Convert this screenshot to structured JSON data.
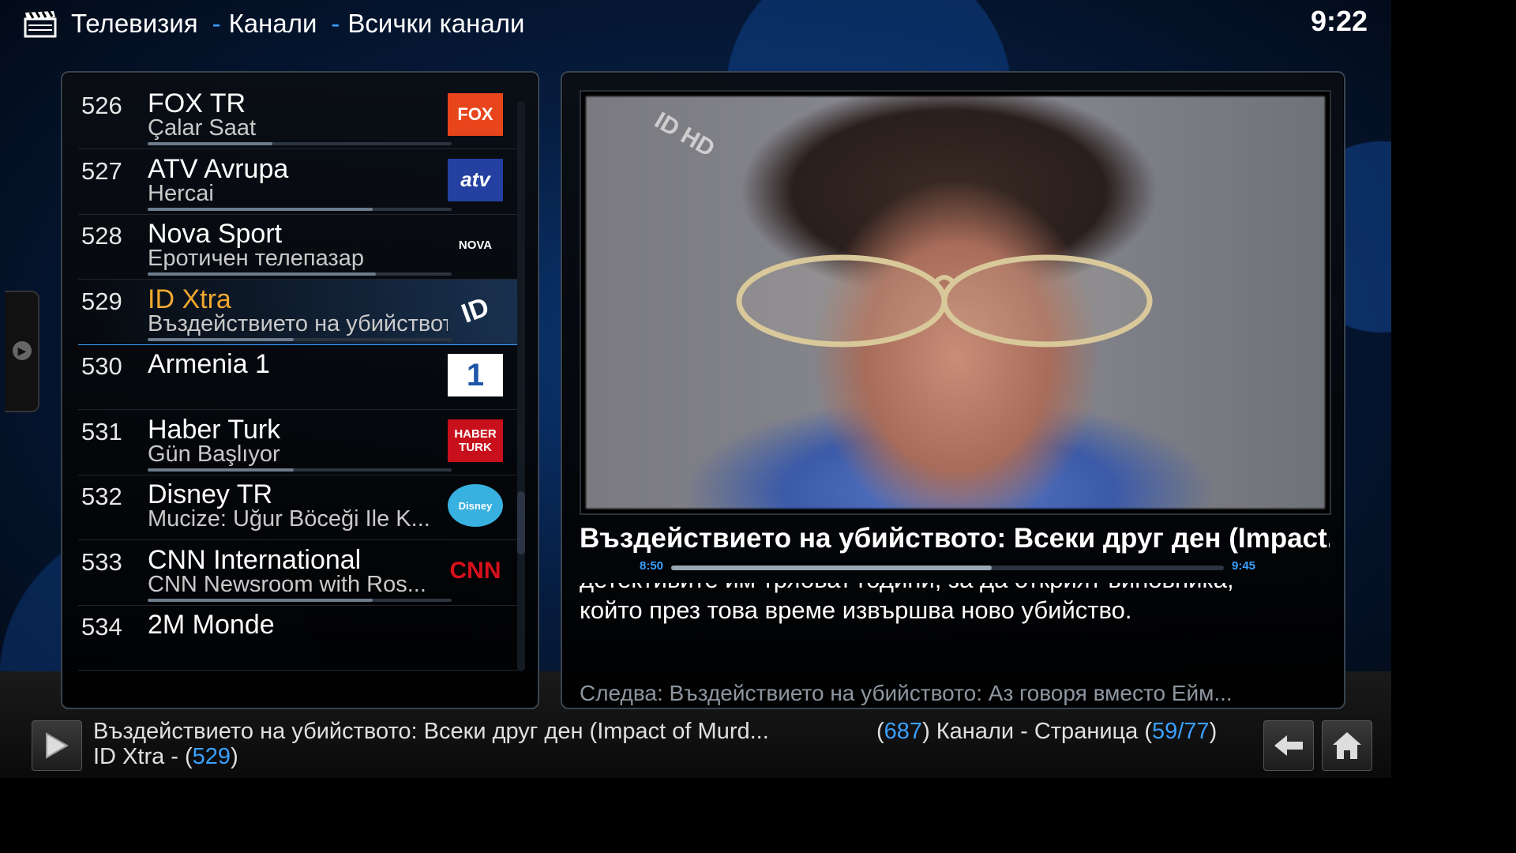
{
  "header": {
    "crumbs": [
      "Телевизия",
      "Канали",
      "Всички канали"
    ],
    "clock": "9:22"
  },
  "channels": [
    {
      "number": "526",
      "name": "FOX TR",
      "program": "Çalar Saat",
      "progress": 0.41,
      "logo": "FOX"
    },
    {
      "number": "527",
      "name": "ATV Avrupa",
      "program": "Hercai",
      "progress": 0.74,
      "logo": "atv"
    },
    {
      "number": "528",
      "name": "Nova Sport",
      "program": "Еротичен телепазар",
      "progress": 0.75,
      "logo": "NOVA"
    },
    {
      "number": "529",
      "name": "ID Xtra",
      "program": "Въздействието на убийството: В",
      "progress": 0.48,
      "logo": "ID",
      "selected": true
    },
    {
      "number": "530",
      "name": "Armenia 1",
      "program": "",
      "progress": null,
      "logo": "1"
    },
    {
      "number": "531",
      "name": "Haber Turk",
      "program": "Gün Başlıyor",
      "progress": 0.48,
      "logo": "HABER TURK"
    },
    {
      "number": "532",
      "name": "Disney TR",
      "program": "Mucize: Uğur Böceği Ile K...",
      "progress": null,
      "logo": "Disney"
    },
    {
      "number": "533",
      "name": "CNN International",
      "program": "CNN Newsroom with Ros...",
      "progress": 0.74,
      "logo": "CNN"
    },
    {
      "number": "534",
      "name": "2M Monde",
      "program": "",
      "progress": null,
      "logo": ""
    }
  ],
  "info": {
    "title": "Въздействието на убийството: Всеки друг ден (Impact...",
    "start": "8:50",
    "end": "9:45",
    "progress": 0.58,
    "plot_line1": "детективите им трябват години, за да открият виновника,",
    "plot_line2": "който през това време извършва ново убийство.",
    "next": "Следва: Въздействието на убийството: Аз говоря вместо Ейм...",
    "preview_watermark": "ID HD"
  },
  "footer": {
    "now_playing": "Въздействието на убийството: Всеки друг ден (Impact of Murd...",
    "channel_prefix": "ID Xtra - (",
    "channel_num": "529",
    "channel_suffix": ")",
    "count_open": "(",
    "count": "687",
    "count_close": ") Канали - Страница (",
    "page": "59/77",
    "page_close": ")"
  },
  "colors": {
    "accent": "#3aa0ff",
    "selected": "#f0a830"
  }
}
